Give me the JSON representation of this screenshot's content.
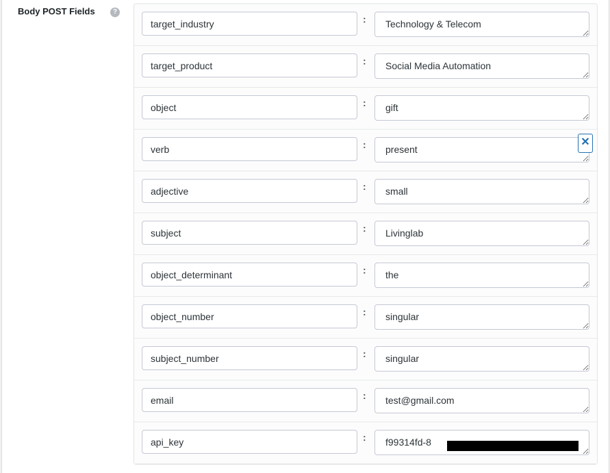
{
  "section": {
    "label": "Body POST Fields",
    "help_icon": "?"
  },
  "separator": ":",
  "remove_icon": "✕",
  "fields": [
    {
      "key": "target_industry",
      "value": "Technology & Telecom"
    },
    {
      "key": "target_product",
      "value": "Social Media Automation"
    },
    {
      "key": "object",
      "value": "gift"
    },
    {
      "key": "verb",
      "value": "present"
    },
    {
      "key": "adjective",
      "value": "small"
    },
    {
      "key": "subject",
      "value": "Livinglab"
    },
    {
      "key": "object_determinant",
      "value": "the"
    },
    {
      "key": "object_number",
      "value": "singular"
    },
    {
      "key": "subject_number",
      "value": "singular"
    },
    {
      "key": "email",
      "value": "test@gmail.com"
    },
    {
      "key": "api_key",
      "value": "f99314fd-8"
    }
  ]
}
